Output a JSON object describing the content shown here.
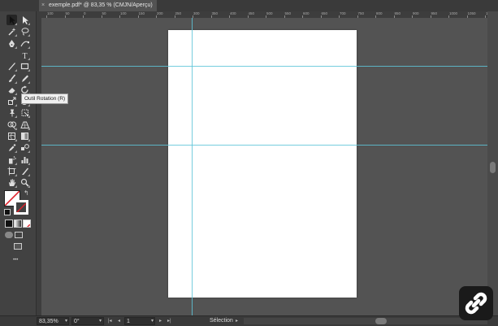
{
  "document": {
    "tab_label": "exemple.pdf* @ 83,35 % (CMJN/Aperçu)",
    "close_glyph": "×"
  },
  "toolbar": {
    "tools": [
      {
        "name": "selection-tool",
        "icon": "arrow-icon"
      },
      {
        "name": "direct-selection-tool",
        "icon": "white-arrow-icon"
      },
      {
        "name": "magic-wand-tool",
        "icon": "magic-wand-icon"
      },
      {
        "name": "lasso-tool",
        "icon": "lasso-icon"
      },
      {
        "name": "pen-tool",
        "icon": "pen-icon"
      },
      {
        "name": "curvature-tool",
        "icon": "curvature-icon"
      },
      {
        "name": "type-tool",
        "icon": "type-icon",
        "glyph": "T"
      },
      {
        "name": "line-tool",
        "icon": "line-icon"
      },
      {
        "name": "rectangle-tool",
        "icon": "rectangle-icon"
      },
      {
        "name": "paintbrush-tool",
        "icon": "brush-icon"
      },
      {
        "name": "pencil-tool",
        "icon": "pencil-icon"
      },
      {
        "name": "eraser-tool",
        "icon": "eraser-icon"
      },
      {
        "name": "rotate-tool",
        "icon": "rotate-icon"
      },
      {
        "name": "scale-tool",
        "icon": "scale-icon"
      },
      {
        "name": "warp-tool",
        "icon": "warp-icon"
      },
      {
        "name": "puppet-warp-tool",
        "icon": "pin-icon"
      },
      {
        "name": "free-transform-tool",
        "icon": "free-transform-icon"
      },
      {
        "name": "shape-builder-tool",
        "icon": "shape-builder-icon"
      },
      {
        "name": "perspective-tool",
        "icon": "perspective-icon"
      },
      {
        "name": "mesh-tool",
        "icon": "mesh-icon"
      },
      {
        "name": "gradient-tool",
        "icon": "gradient-icon"
      },
      {
        "name": "eyedropper-tool",
        "icon": "eyedropper-icon"
      },
      {
        "name": "blend-tool",
        "icon": "blend-icon"
      },
      {
        "name": "symbol-sprayer-tool",
        "icon": "spray-icon"
      },
      {
        "name": "column-graph-tool",
        "icon": "graph-icon"
      },
      {
        "name": "artboard-tool",
        "icon": "artboard-icon"
      },
      {
        "name": "slice-tool",
        "icon": "slice-icon"
      },
      {
        "name": "hand-tool",
        "icon": "hand-icon"
      },
      {
        "name": "zoom-tool",
        "icon": "zoom-icon"
      }
    ],
    "more_glyph": "•••"
  },
  "tooltip": {
    "text": "Outil Rotation (R)"
  },
  "ruler": {
    "top_labels": [
      "100",
      "50",
      "0",
      "50",
      "100",
      "150",
      "200",
      "250",
      "300",
      "350",
      "400",
      "450",
      "500",
      "550",
      "600",
      "650",
      "700",
      "750",
      "800",
      "850",
      "900",
      "950",
      "1000",
      "1050",
      "1100"
    ]
  },
  "status": {
    "zoom": "83,35%",
    "rotation": "0°",
    "artboard_number": "1",
    "mode": "Sélection"
  },
  "colors": {
    "guide": "#5ec4d8",
    "artboard": "#ffffff",
    "pasteboard": "#535353",
    "no_fill_slash": "#e0202a"
  }
}
